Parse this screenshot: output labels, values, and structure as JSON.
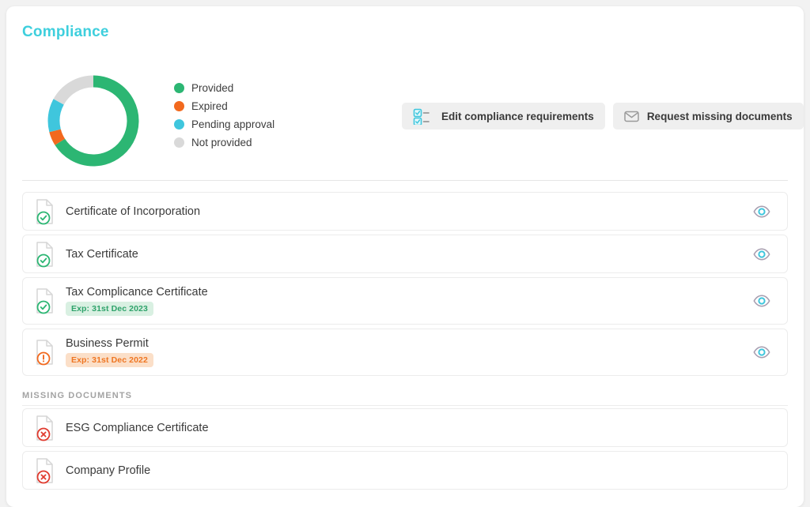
{
  "card": {
    "title": "Compliance"
  },
  "chart_data": {
    "type": "pie",
    "title": "Compliance",
    "variant": "donut",
    "categories": [
      "Provided",
      "Expired",
      "Pending approval",
      "Not provided"
    ],
    "values": [
      66,
      5,
      12,
      17
    ],
    "unit": "percent",
    "colors": [
      "#2cb673",
      "#f2691e",
      "#3fc6dd",
      "#d9d9d9"
    ],
    "legend_position": "right",
    "start_angle_deg": 0,
    "direction": "clockwise",
    "inner_radius_ratio": 0.66
  },
  "legend": {
    "items": [
      {
        "label": "Provided",
        "color": "#2cb673"
      },
      {
        "label": "Expired",
        "color": "#f2691e"
      },
      {
        "label": "Pending approval",
        "color": "#3fc6dd"
      },
      {
        "label": "Not provided",
        "color": "#d9d9d9"
      }
    ]
  },
  "actions": {
    "edit_requirements": {
      "label": "Edit compliance requirements",
      "icon": "checklist-icon"
    },
    "request_documents": {
      "label": "Request missing documents",
      "icon": "envelope-icon"
    }
  },
  "documents": [
    {
      "name": "Certificate of Incorporation",
      "status": "provided",
      "status_icon": "check-circle-icon",
      "badge": null,
      "view_icon": "eye-icon"
    },
    {
      "name": "Tax Certificate",
      "status": "provided",
      "status_icon": "check-circle-icon",
      "badge": null,
      "view_icon": "eye-icon"
    },
    {
      "name": "Tax Complicance Certificate",
      "status": "provided",
      "status_icon": "check-circle-icon",
      "badge": "Exp: 31st Dec 2023",
      "badge_style": "ok",
      "view_icon": "eye-icon"
    },
    {
      "name": "Business Permit",
      "status": "expired",
      "status_icon": "alert-circle-icon",
      "badge": "Exp: 31st Dec 2022",
      "badge_style": "warn",
      "view_icon": "eye-icon"
    }
  ],
  "missing_section": {
    "label": "MISSING DOCUMENTS",
    "documents": [
      {
        "name": "ESG Compliance Certificate",
        "status": "missing",
        "status_icon": "x-circle-icon"
      },
      {
        "name": "Company Profile",
        "status": "missing",
        "status_icon": "x-circle-icon"
      }
    ]
  },
  "colors": {
    "title": "#3ecfdd",
    "provided": "#2cb673",
    "expired": "#f2691e",
    "pending": "#3fc6dd",
    "not_provided": "#d9d9d9",
    "missing": "#e03b2f",
    "button_bg": "#efefef",
    "page_bg": "#f2f2f2"
  }
}
